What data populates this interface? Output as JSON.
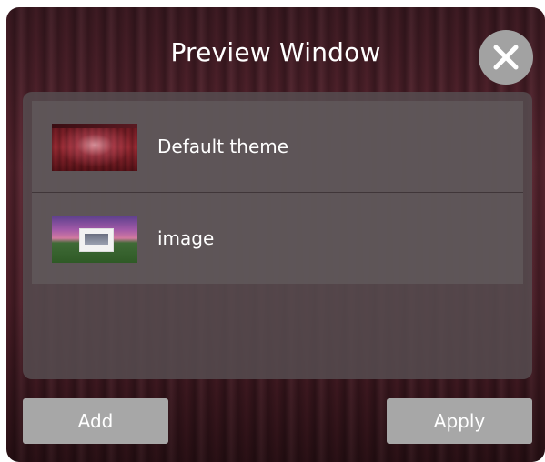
{
  "window": {
    "title": "Preview Window",
    "close_icon": "close-icon"
  },
  "themes": {
    "items": [
      {
        "label": "Default theme",
        "thumbnail": "default-theme-thumbnail"
      },
      {
        "label": "image",
        "thumbnail": "image-thumbnail"
      }
    ]
  },
  "actions": {
    "add_label": "Add",
    "apply_label": "Apply"
  },
  "colors": {
    "button_gray": "#a7a7a7",
    "close_circle": "#a2a2a2",
    "text": "#ffffff",
    "background": "#4e1f29"
  }
}
